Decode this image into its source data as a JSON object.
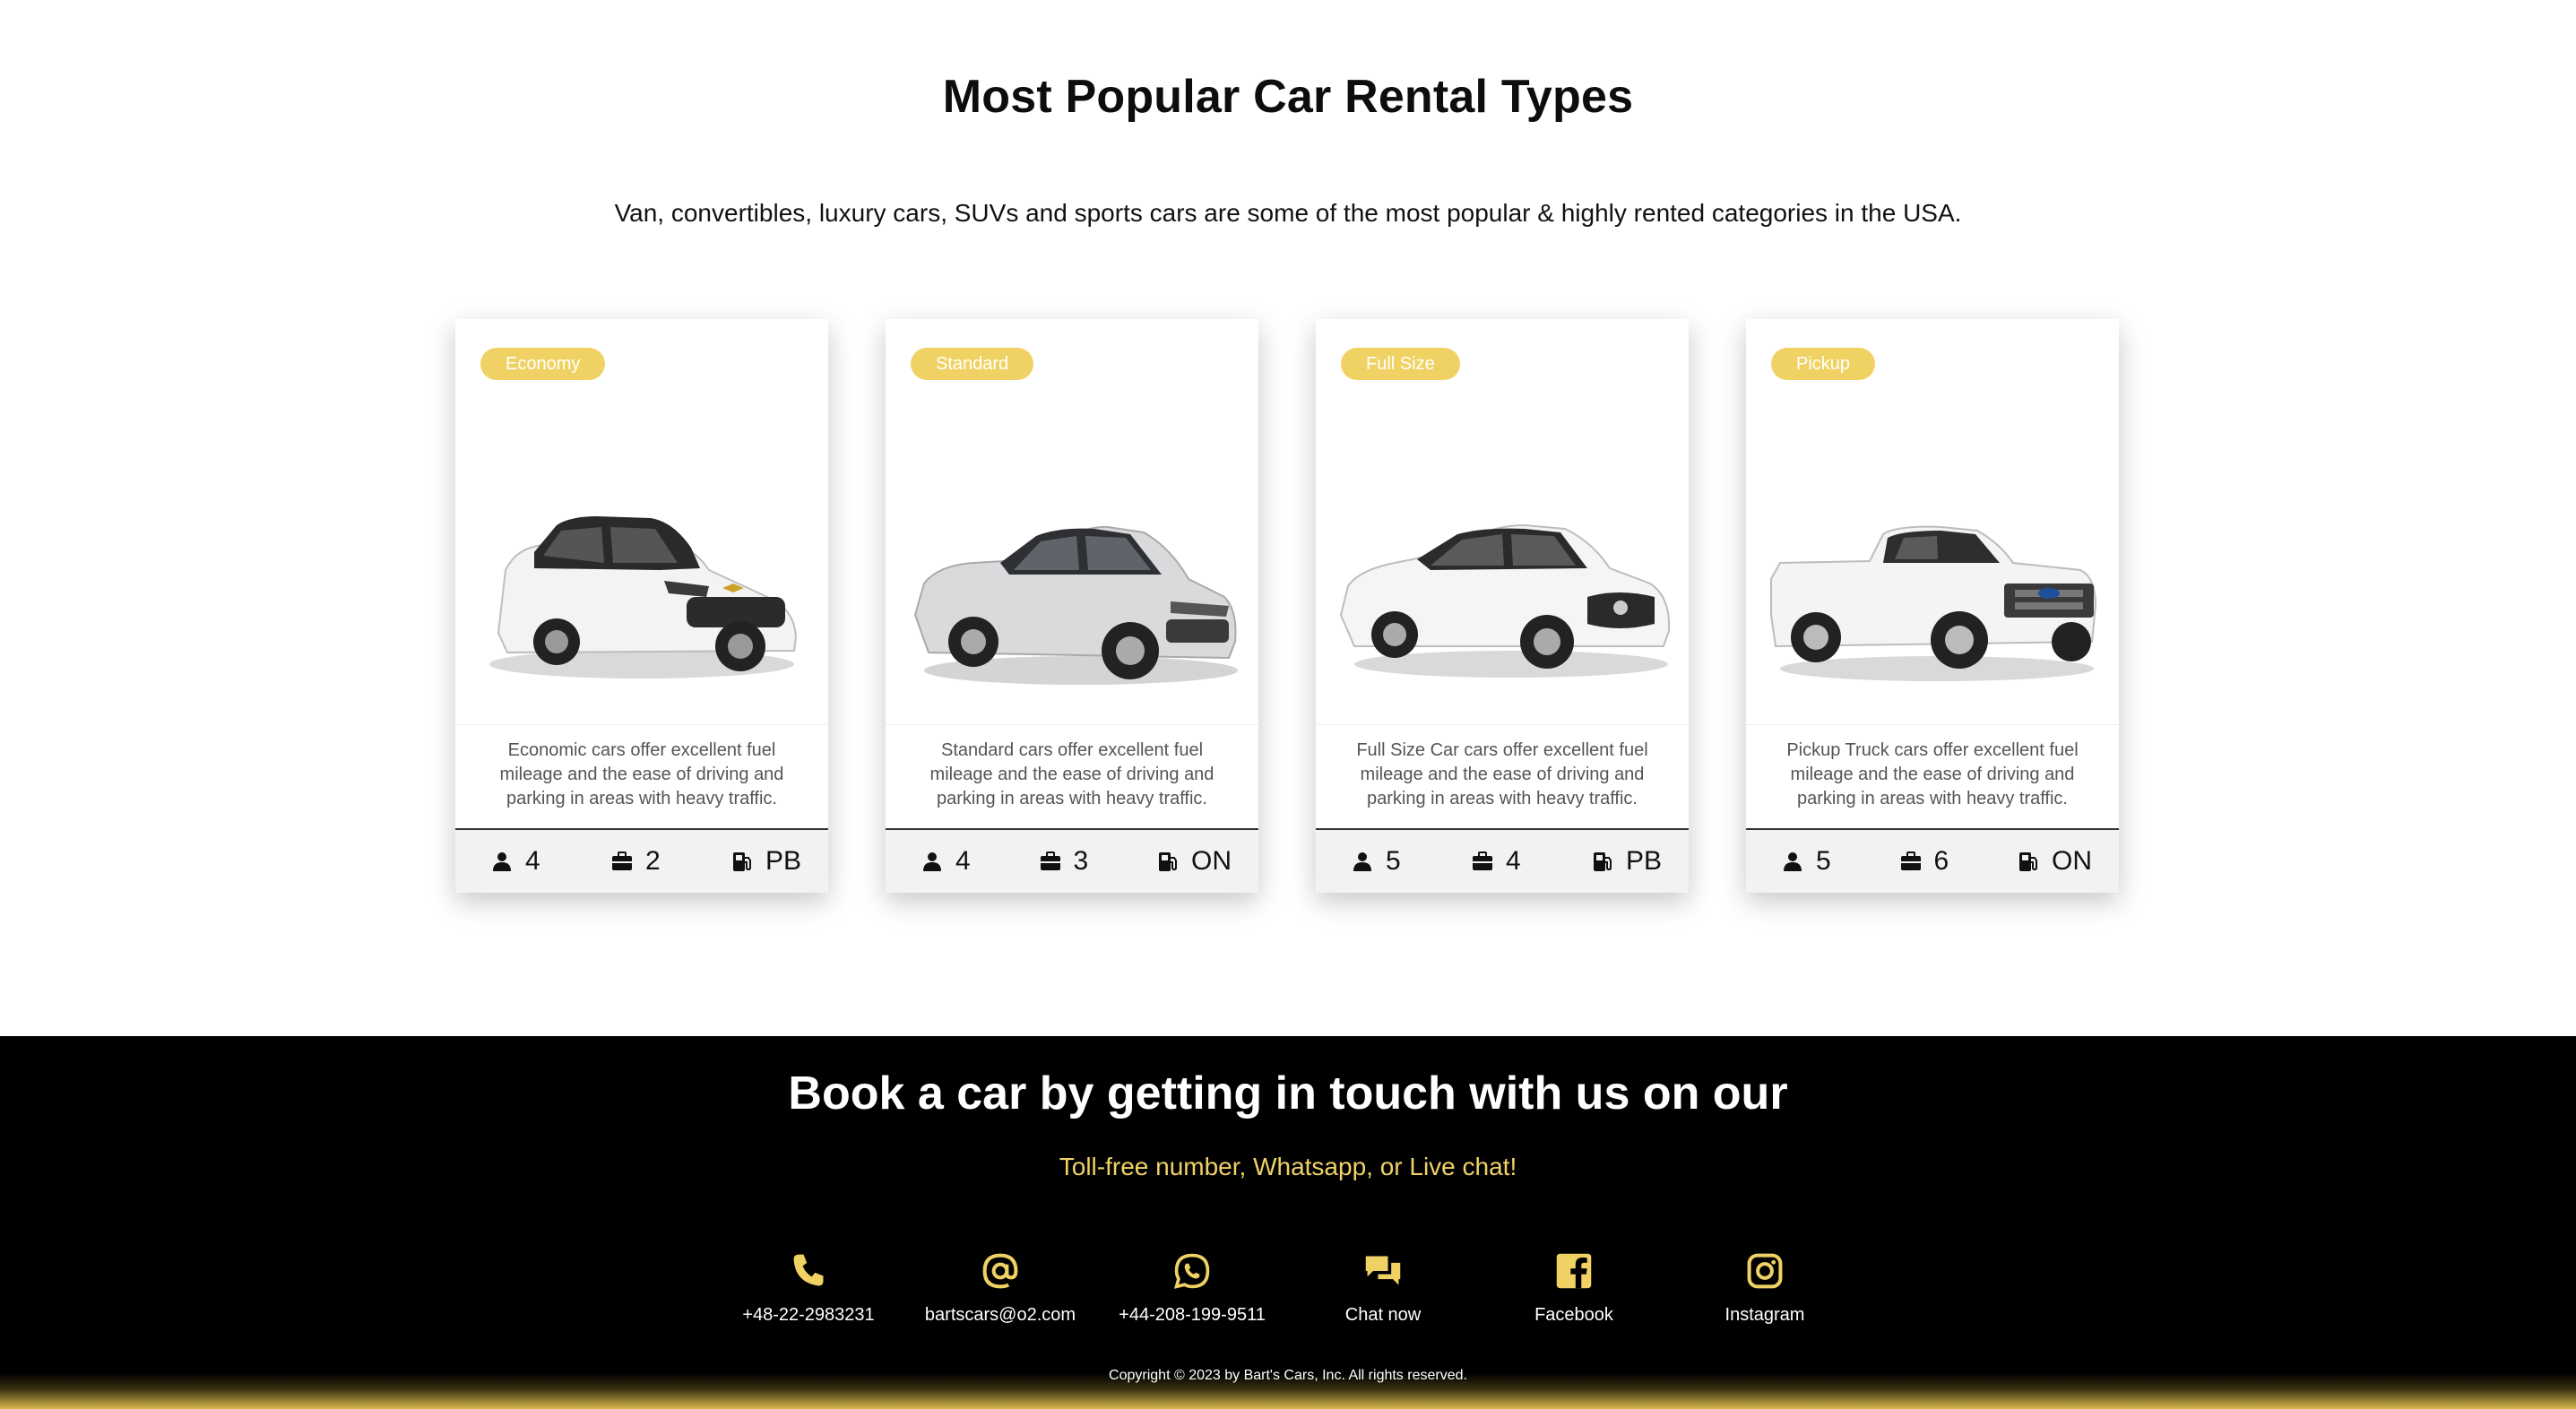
{
  "section": {
    "title": "Most Popular Car Rental Types",
    "subtitle": "Van, convertibles, luxury cars, SUVs and sports cars are some of the most popular & highly rented categories in the USA."
  },
  "cars": [
    {
      "badge": "Economy",
      "description": "Economic cars offer excellent fuel mileage and the ease of driving and parking in areas with heavy traffic.",
      "passengers": "4",
      "bags": "2",
      "fuel": "PB"
    },
    {
      "badge": "Standard",
      "description": "Standard cars offer excellent fuel mileage and the ease of driving and parking in areas with heavy traffic.",
      "passengers": "4",
      "bags": "3",
      "fuel": "ON"
    },
    {
      "badge": "Full Size",
      "description": "Full Size Car cars offer excellent fuel mileage and the ease of driving and parking in areas with heavy traffic.",
      "passengers": "5",
      "bags": "4",
      "fuel": "PB"
    },
    {
      "badge": "Pickup",
      "description": "Pickup Truck cars offer excellent fuel mileage and the ease of driving and parking in areas with heavy traffic.",
      "passengers": "5",
      "bags": "6",
      "fuel": "ON"
    }
  ],
  "footer": {
    "title": "Book a car by getting in touch with us on our",
    "subtitle": "Toll-free number, Whatsapp, or Live chat!",
    "contacts": [
      {
        "icon": "phone-icon",
        "label": "+48-22-2983231"
      },
      {
        "icon": "at-icon",
        "label": "bartscars@o2.com"
      },
      {
        "icon": "whatsapp-icon",
        "label": "+44-208-199-9511"
      },
      {
        "icon": "chat-icon",
        "label": "Chat now"
      },
      {
        "icon": "facebook-icon",
        "label": "Facebook"
      },
      {
        "icon": "instagram-icon",
        "label": "Instagram"
      }
    ],
    "copyright": "Copyright © 2023 by Bart's Cars, Inc. All rights reserved."
  },
  "colors": {
    "accent": "#f0d264",
    "footer_bg": "#000000",
    "text": "#111111"
  }
}
